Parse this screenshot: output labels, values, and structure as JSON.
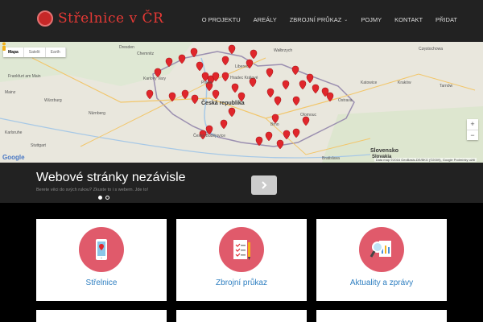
{
  "header": {
    "logo_text": "Střelnice v ČR",
    "nav": [
      {
        "label": "O projektu"
      },
      {
        "label": "Areály"
      },
      {
        "label": "Zbrojní průkaz",
        "has_dropdown": true
      },
      {
        "label": "Pojmy"
      },
      {
        "label": "Kontakt"
      },
      {
        "label": "Přidat"
      }
    ]
  },
  "map": {
    "map_types": [
      "Mapa",
      "Satelit",
      "Earth"
    ],
    "selected_type": "Mapa",
    "country_label": "Česká republika",
    "countries": [
      "Slovensko",
      "Slovakia"
    ],
    "cities": [
      "Dresden",
      "Chemnitz",
      "Liberec",
      "Wałbrzych",
      "Częstochowa",
      "Frankfurt am Main",
      "Mainz",
      "Würzburg",
      "Nürnberg",
      "Karlovy Vary",
      "Praha",
      "Hradec Králové",
      "Katowice",
      "Kraków",
      "Tarnów",
      "Olomouc",
      "Brno",
      "Ostrava",
      "Stuttgart",
      "Karlsruhe",
      "České Budějovice",
      "Bratislava"
    ],
    "zoom_in": "+",
    "zoom_out": "−",
    "google": "Google",
    "attribution": "Data map ©2016 GeoBasis-DE/BKG (©2009), Google   Podmínky užití"
  },
  "slider": {
    "title": "Webové stránky nezávisle",
    "subtitle": "Berete věci do svých rukou? Zkuste to i s webem. Jde to!",
    "slide_count": 2,
    "active_slide": 1
  },
  "cards": [
    {
      "label": "Střelnice"
    },
    {
      "label": "Zbrojní průkaz"
    },
    {
      "label": "Aktuality a zprávy"
    }
  ],
  "colors": {
    "accent_red": "#e05a6b",
    "link_blue": "#2f7fc1",
    "marker_red": "#e0262b"
  }
}
